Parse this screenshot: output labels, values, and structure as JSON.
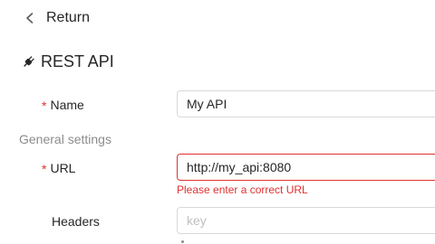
{
  "nav": {
    "return_label": "Return"
  },
  "header": {
    "title": "REST API",
    "icon": "plug-icon"
  },
  "form": {
    "required_mark": "*",
    "name": {
      "label": "Name",
      "value": "My API",
      "required": true
    },
    "section_label": "General settings",
    "url": {
      "label": "URL",
      "value": "http://my_api:8080",
      "required": true,
      "error": "Please enter a correct URL"
    },
    "headers": {
      "label": "Headers",
      "key_placeholder": "key"
    }
  },
  "colors": {
    "error": "#e03131",
    "muted": "#8c8c8c",
    "border": "#d9d9d9"
  }
}
